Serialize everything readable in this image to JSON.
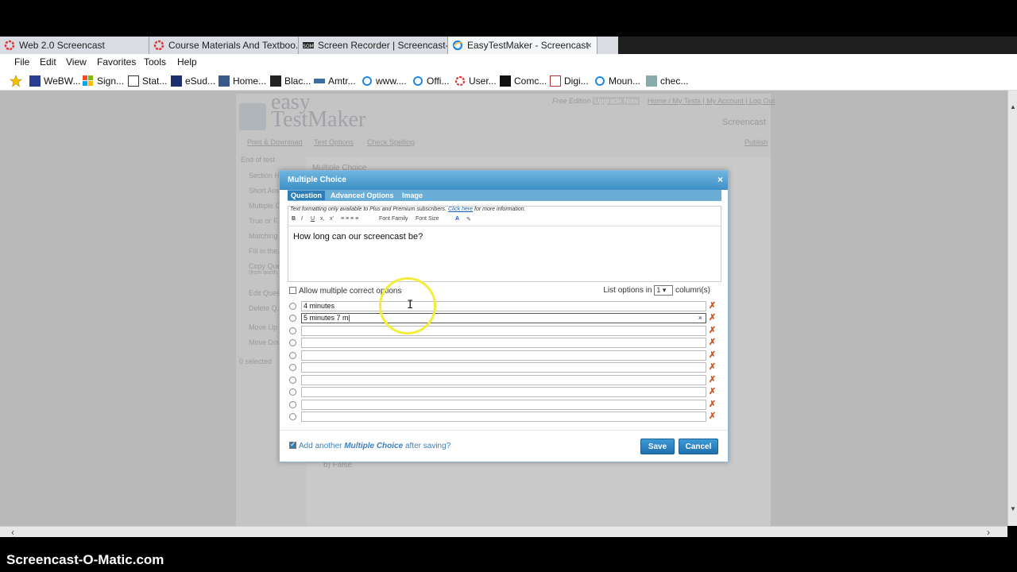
{
  "tabs": [
    {
      "label": "Web 2.0 Screencast",
      "icon": "red-ring-icon",
      "active": false
    },
    {
      "label": "Course Materials And Textboo...",
      "icon": "red-ring-icon",
      "active": false
    },
    {
      "label": "Screen Recorder | Screencast-...",
      "icon": "som-logo-icon",
      "active": false
    },
    {
      "label": "EasyTestMaker - Screencast",
      "icon": "ie-icon",
      "active": true
    }
  ],
  "tab_close": "×",
  "menu": [
    "File",
    "Edit",
    "View",
    "Favorites",
    "Tools",
    "Help"
  ],
  "favorites": [
    "WeBW...",
    "Sign...",
    "Stat...",
    "eSud...",
    "Home...",
    "Blac...",
    "Amtr...",
    "www....",
    "Offi...",
    "User...",
    "Comc...",
    "Digi...",
    "Moun...",
    "chec..."
  ],
  "bg_page": {
    "logo_line1": "easy",
    "logo_line2": "TestMaker",
    "free_edition": "Free Edition",
    "upgrade": "Upgrade Now",
    "top_links": "Home / My Tests | My Account | Log Out",
    "screencast": "Screencast",
    "print": "Print & Download",
    "test_options": "Test Options",
    "check_spelling": "Check Spelling",
    "publish": "Publish",
    "end_of_test": "End of test",
    "left_items": [
      "Section H...",
      "Short Ans...",
      "Multiple C...",
      "True or F...",
      "Matching",
      "Fill in the...",
      "Copy Que...",
      "(from anoth...",
      "Edit Ques...",
      "Delete Q...",
      "Move Up",
      "Move Dow...",
      "0 selected"
    ],
    "main_heading": "Multiple Choice",
    "false_label": "b) False"
  },
  "modal": {
    "title": "Multiple Choice",
    "close": "×",
    "tabs": [
      "Question",
      "Advanced Options",
      "Image"
    ],
    "note_prefix": "Text formatting only available to Plus and Premium subscribers.",
    "note_link": "Click here",
    "note_suffix": "for more information.",
    "toolbar": [
      "B",
      "I",
      "U",
      "x,",
      "x'",
      "Font Family",
      "Font Size",
      "A",
      "✎"
    ],
    "question": "How long can our screencast be?",
    "allow_multiple": "Allow multiple correct options",
    "list_options_prefix": "List options in",
    "list_options_value": "1",
    "list_options_suffix": "column(s)",
    "options": [
      "4 minutes",
      "5 minutes 7 m",
      "",
      "",
      "",
      "",
      "",
      "",
      "",
      ""
    ],
    "add_another_prefix": "Add another",
    "add_another_type": "Multiple Choice",
    "add_another_suffix": "after saving?",
    "save": "Save",
    "cancel": "Cancel"
  },
  "watermark": "Screencast-O-Matic.com",
  "colors": {
    "accent": "#2f7fb6",
    "delete": "#d9531e",
    "highlight_ring": "#f3ee3c"
  }
}
